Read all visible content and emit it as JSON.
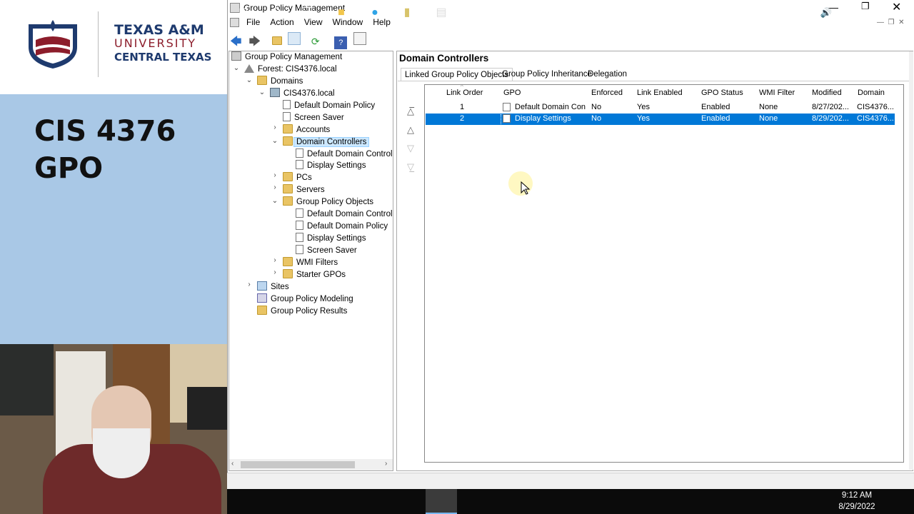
{
  "banner": {
    "university": [
      "TEXAS A&M",
      "UNIVERSITY",
      "CENTRAL TEXAS"
    ],
    "course": "CIS 4376",
    "topic": "GPO"
  },
  "window": {
    "title": "Group Policy Management",
    "menu": [
      "File",
      "Action",
      "View",
      "Window",
      "Help"
    ]
  },
  "tree": {
    "root": "Group Policy Management",
    "forest": "Forest: CIS4376.local",
    "domains": "Domains",
    "domain": "CIS4376.local",
    "ddp": "Default Domain Policy",
    "screensaver": "Screen Saver",
    "accounts": "Accounts",
    "dc": "Domain Controllers",
    "dc_child1": "Default Domain Control",
    "dc_child2": "Display Settings",
    "pcs": "PCs",
    "servers": "Servers",
    "gpo": "Group Policy Objects",
    "gpo_child1": "Default Domain Control",
    "gpo_child2": "Default Domain Policy",
    "gpo_child3": "Display Settings",
    "gpo_child4": "Screen Saver",
    "wmi": "WMI Filters",
    "starter": "Starter GPOs",
    "sites": "Sites",
    "modeling": "Group Policy Modeling",
    "results": "Group Policy Results"
  },
  "detail": {
    "heading": "Domain Controllers",
    "tabs": [
      "Linked Group Policy Objects",
      "Group Policy Inheritance",
      "Delegation"
    ],
    "columns": [
      "Link Order",
      "GPO",
      "Enforced",
      "Link Enabled",
      "GPO Status",
      "WMI Filter",
      "Modified",
      "Domain"
    ],
    "rows": [
      [
        "1",
        "Default Domain Con...",
        "No",
        "Yes",
        "Enabled",
        "None",
        "8/27/202...",
        "CIS4376..."
      ],
      [
        "2",
        "Display Settings",
        "No",
        "Yes",
        "Enabled",
        "None",
        "8/29/202...",
        "CIS4376..."
      ]
    ]
  },
  "taskbar": {
    "time": "9:12 AM",
    "date": "8/29/2022"
  },
  "colors": {
    "accent": "#0078d7",
    "banner_blue": "#a9c8e6",
    "aggie_maroon": "#8c1d2b"
  }
}
